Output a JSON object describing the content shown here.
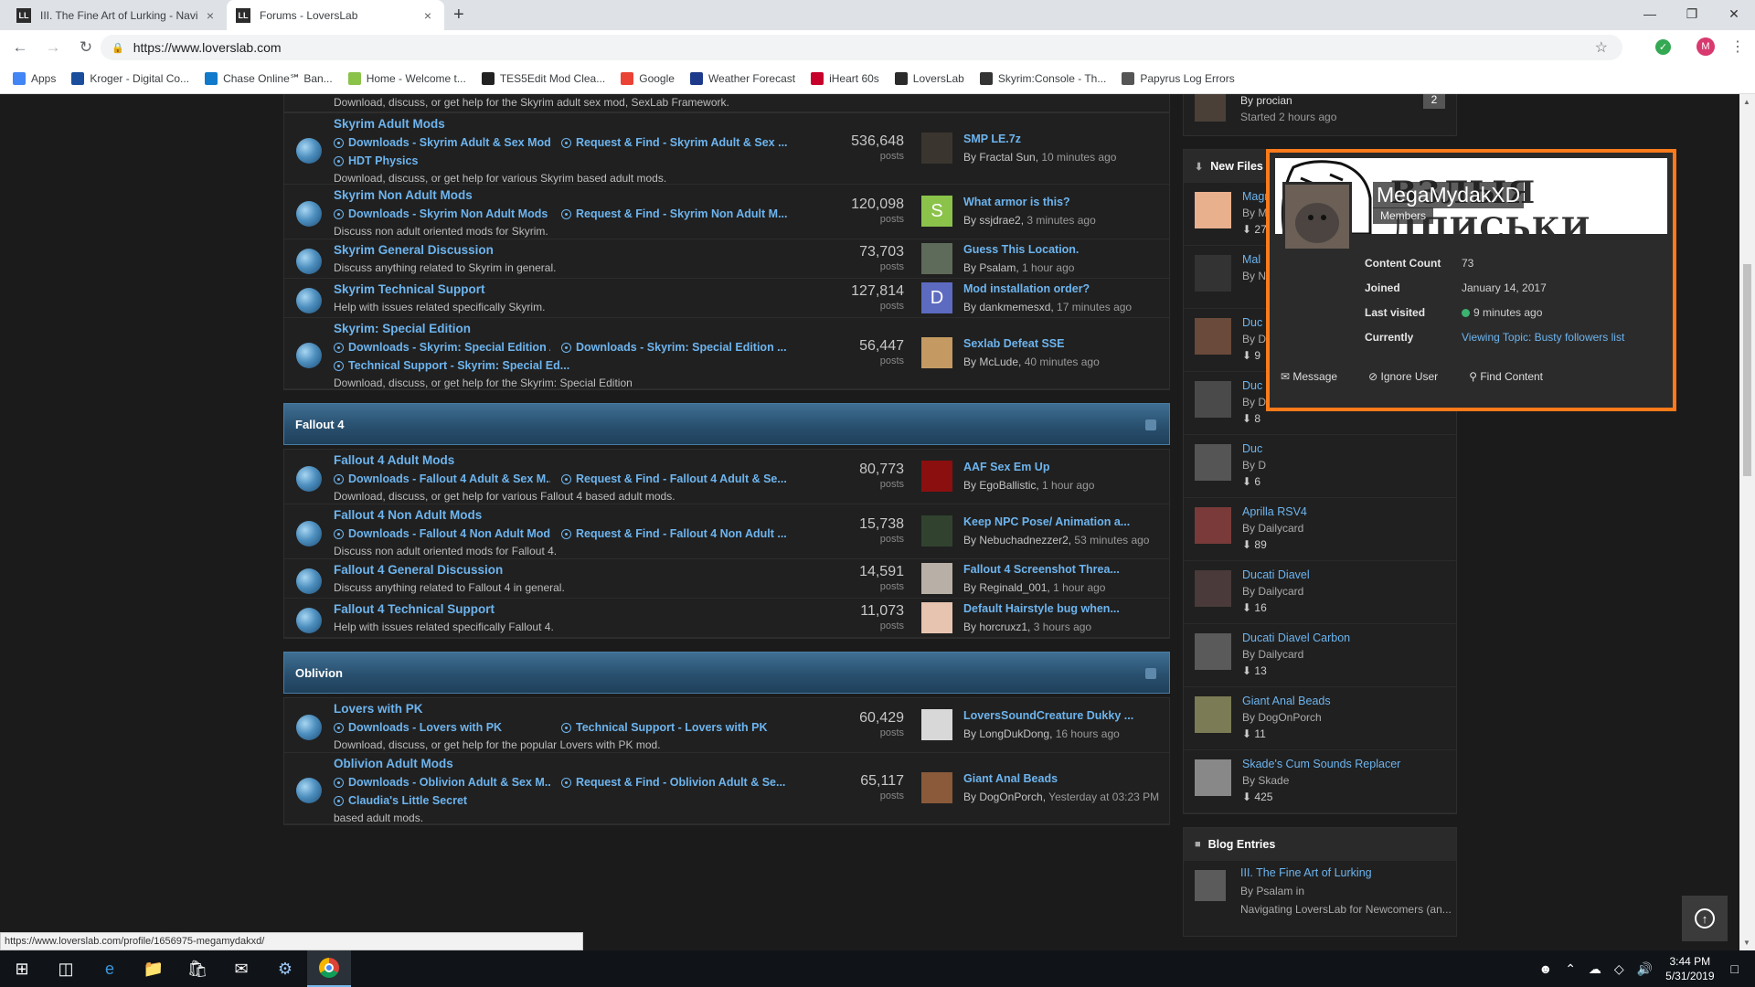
{
  "browser": {
    "tabs": [
      {
        "title": "III. The Fine Art of Lurking - Navi",
        "active": false
      },
      {
        "title": "Forums - LoversLab",
        "active": true
      }
    ],
    "url": "https://www.loverslab.com",
    "bookmarks": [
      {
        "label": "Apps",
        "icon": "apps-grid-icon",
        "color": "#4285f4"
      },
      {
        "label": "Kroger - Digital Co...",
        "icon": "kroger-icon",
        "color": "#1a4d9c"
      },
      {
        "label": "Chase Online℠ Ban...",
        "icon": "chase-icon",
        "color": "#117aca"
      },
      {
        "label": "Home - Welcome t...",
        "icon": "w-icon",
        "color": "#8bc34a"
      },
      {
        "label": "TES5Edit Mod Clea...",
        "icon": "tes5edit-icon",
        "color": "#222222"
      },
      {
        "label": "Google",
        "icon": "google-icon",
        "color": "#ea4335"
      },
      {
        "label": "Weather Forecast",
        "icon": "weather-icon",
        "color": "#1d3a8a"
      },
      {
        "label": "iHeart 60s",
        "icon": "iheart-icon",
        "color": "#c6002b"
      },
      {
        "label": "LoversLab",
        "icon": "loverslab-icon",
        "color": "#2b2b2b"
      },
      {
        "label": "Skyrim:Console - Th...",
        "icon": "skyrim-icon",
        "color": "#333333"
      },
      {
        "label": "Papyrus Log Errors",
        "icon": "papyrus-icon",
        "color": "#555555"
      }
    ]
  },
  "top_partial_desc": "Download, discuss, or get help for the Skyrim adult sex mod, SexLab Framework.",
  "skyrim_rows": [
    {
      "title": "Skyrim Adult Mods",
      "subs": [
        "Downloads - Skyrim Adult & Sex Mods",
        "Request & Find - Skyrim Adult & Sex ...",
        "HDT Physics"
      ],
      "desc": "Download, discuss, or get help for various Skyrim based adult mods.",
      "posts": "536,648",
      "posts_label": "posts",
      "last_title": "SMP LE.7z",
      "last_by": "By Fractal Sun",
      "last_time": "10 minutes ago",
      "avatar": "dark-face"
    },
    {
      "title": "Skyrim Non Adult Mods",
      "subs": [
        "Downloads - Skyrim Non Adult Mods",
        "Request & Find - Skyrim Non Adult M..."
      ],
      "desc": "Discuss non adult oriented mods for Skyrim.",
      "posts": "120,098",
      "posts_label": "posts",
      "last_title": "What armor is this?",
      "last_by": "By ssjdrae2",
      "last_time": "3 minutes ago",
      "avatar": "S"
    },
    {
      "title": "Skyrim General Discussion",
      "subs": [],
      "desc": "Discuss anything related to Skyrim in general.",
      "posts": "73,703",
      "posts_label": "posts",
      "last_title": "Guess This Location.",
      "last_by": "By Psalam",
      "last_time": "1 hour ago",
      "avatar": "tree"
    },
    {
      "title": "Skyrim Technical Support",
      "subs": [],
      "desc": "Help with issues related specifically Skyrim.",
      "posts": "127,814",
      "posts_label": "posts",
      "last_title": "Mod installation order?",
      "last_by": "By dankmemesxd",
      "last_time": "17 minutes ago",
      "avatar": "D"
    },
    {
      "title": "Skyrim: Special Edition",
      "subs": [
        "Downloads - Skyrim: Special Edition A...",
        "Downloads - Skyrim: Special Edition ...",
        "Technical Support - Skyrim: Special Ed..."
      ],
      "desc": "Download, discuss, or get help for the Skyrim: Special Edition",
      "posts": "56,447",
      "posts_label": "posts",
      "last_title": "Sexlab Defeat SSE",
      "last_by": "By McLude",
      "last_time": "40 minutes ago",
      "avatar": "girl"
    }
  ],
  "fallout_cat": {
    "title": "Fallout 4"
  },
  "fallout_rows": [
    {
      "title": "Fallout 4 Adult Mods",
      "subs": [
        "Downloads - Fallout 4 Adult & Sex M...",
        "Request & Find - Fallout 4 Adult & Se..."
      ],
      "desc": "Download, discuss, or get help for various Fallout 4 based adult mods.",
      "posts": "80,773",
      "posts_label": "posts",
      "last_title": "AAF Sex Em Up",
      "last_by": "By EgoBallistic",
      "last_time": "1 hour ago",
      "avatar": "red-skull"
    },
    {
      "title": "Fallout 4 Non Adult Mods",
      "subs": [
        "Downloads - Fallout 4 Non Adult Mods",
        "Request & Find - Fallout 4 Non Adult ..."
      ],
      "desc": "Discuss non adult oriented mods for Fallout 4.",
      "posts": "15,738",
      "posts_label": "posts",
      "last_title": "Keep NPC Pose/ Animation a...",
      "last_by": "By Nebuchadnezzer2",
      "last_time": "53 minutes ago",
      "avatar": "helmet"
    },
    {
      "title": "Fallout 4 General Discussion",
      "subs": [],
      "desc": "Discuss anything related to Fallout 4 in general.",
      "posts": "14,591",
      "posts_label": "posts",
      "last_title": "Fallout 4 Screenshot Threa...",
      "last_by": "By Reginald_001",
      "last_time": "1 hour ago",
      "avatar": "portrait"
    },
    {
      "title": "Fallout 4 Technical Support",
      "subs": [],
      "desc": "Help with issues related specifically Fallout 4.",
      "posts": "11,073",
      "posts_label": "posts",
      "last_title": "Default Hairstyle bug when...",
      "last_by": "By horcruxz1",
      "last_time": "3 hours ago",
      "avatar": "baby"
    }
  ],
  "oblivion_cat": {
    "title": "Oblivion"
  },
  "oblivion_rows": [
    {
      "title": "Lovers with PK",
      "subs": [
        "Downloads - Lovers with PK",
        "Technical Support - Lovers with PK"
      ],
      "desc": "Download, discuss, or get help for the popular Lovers with PK mod.",
      "posts": "60,429",
      "posts_label": "posts",
      "last_title": "LoversSoundCreature Dukky ...",
      "last_by": "By LongDukDong",
      "last_time": "16 hours ago",
      "avatar": "text-pic"
    },
    {
      "title": "Oblivion Adult Mods",
      "subs": [
        "Downloads - Oblivion Adult & Sex M...",
        "Request & Find - Oblivion Adult & Se...",
        "Claudia's Little Secret"
      ],
      "desc": "based adult mods.",
      "posts": "65,117",
      "posts_label": "posts",
      "last_title": "Giant Anal Beads",
      "last_by": "By DogOnPorch",
      "last_time": "Yesterday at 03:23 PM",
      "avatar": "dog"
    }
  ],
  "sidebar": {
    "topic_partial": {
      "by": "By procian",
      "started": "Started 2 hours ago",
      "count": "2"
    },
    "new_files_title": "New Files",
    "files": [
      {
        "title": "Magni-Busty beach elf",
        "by": "By MegaMydakXD",
        "dl": "27"
      },
      {
        "title": "Mal",
        "by": "By N",
        "dl": "",
        "hidden": true
      },
      {
        "title": "Duc",
        "by": "By D",
        "dl": "9",
        "hidden": true
      },
      {
        "title": "Duc",
        "by": "By D",
        "dl": "8",
        "hidden": true
      },
      {
        "title": "Duc",
        "by": "By D",
        "dl": "6",
        "hidden": true
      },
      {
        "title": "Aprilla RSV4",
        "by": "By Dailycard",
        "dl": "89"
      },
      {
        "title": "Ducati Diavel",
        "by": "By Dailycard",
        "dl": "16"
      },
      {
        "title": "Ducati Diavel Carbon",
        "by": "By Dailycard",
        "dl": "13"
      },
      {
        "title": "Giant Anal Beads",
        "by": "By DogOnPorch",
        "dl": "11"
      },
      {
        "title": "Skade's Cum Sounds Replacer",
        "by": "By Skade",
        "dl": "425"
      }
    ],
    "blog_title": "Blog Entries",
    "blog": {
      "title": "III. The Fine Art of Lurking",
      "by": "By Psalam in",
      "sub": "Navigating LoversLab for Newcomers (an..."
    }
  },
  "hovercard": {
    "username": "MegaMydakXD",
    "group": "Members",
    "banner_text": "ВЗЛЫЯ ДПИСЬКИ",
    "rows": [
      {
        "key": "Content Count",
        "value": "73"
      },
      {
        "key": "Joined",
        "value": "January 14, 2017"
      },
      {
        "key": "Last visited",
        "value": "9 minutes ago"
      },
      {
        "key": "Currently",
        "value": "Viewing Topic: Busty followers list"
      }
    ],
    "actions": {
      "message": "Message",
      "ignore": "Ignore User",
      "find": "Find Content"
    },
    "border_color": "#ff7a1a"
  },
  "status_url": "https://www.loverslab.com/profile/1656975-megamydakxd/",
  "clock": {
    "time": "3:44 PM",
    "date": "5/31/2019"
  }
}
